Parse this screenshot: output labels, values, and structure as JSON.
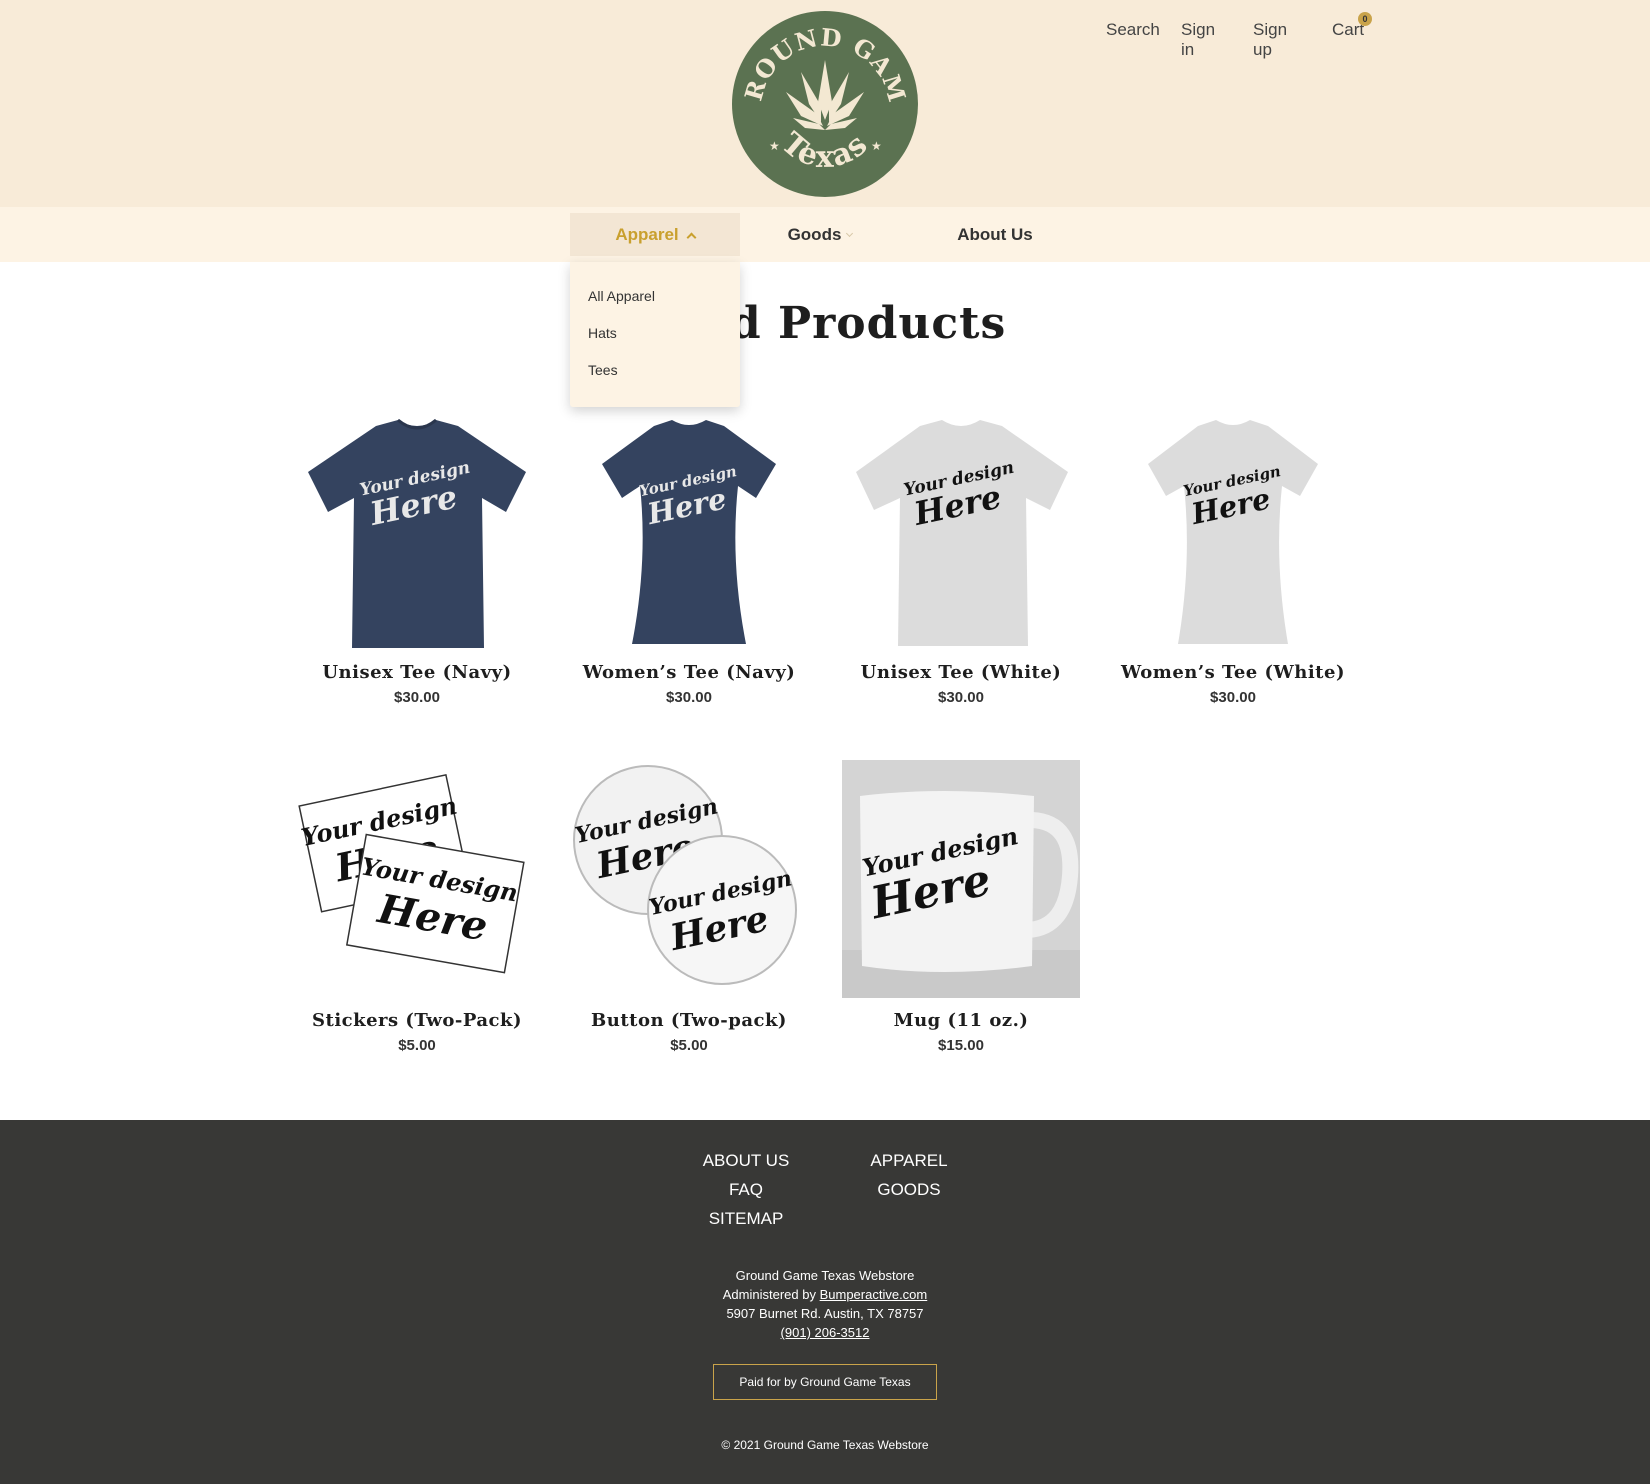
{
  "brand": {
    "logo_top_text": "GROUND GAME",
    "logo_bottom_text": "Texas",
    "colors": {
      "logo_green": "#5b7251",
      "logo_cream": "#f3e8d2",
      "accent": "#c9a02e",
      "header_bg": "#f8ebd8",
      "footer_bg": "#383836"
    }
  },
  "topnav": {
    "search": "Search",
    "signin": "Sign in",
    "signup": "Sign up",
    "cart": "Cart",
    "cart_count": "0"
  },
  "catnav": {
    "apparel": "Apparel",
    "goods": "Goods",
    "about": "About Us"
  },
  "dropdown": {
    "items": [
      "All Apparel",
      "Hats",
      "Tees"
    ]
  },
  "main": {
    "heading": "ured Products"
  },
  "products": [
    {
      "name": "Unisex Tee (Navy)",
      "price": "$30.00"
    },
    {
      "name": "Women’s Tee (Navy)",
      "price": "$30.00"
    },
    {
      "name": "Unisex Tee (White)",
      "price": "$30.00"
    },
    {
      "name": "Women’s Tee (White)",
      "price": "$30.00"
    },
    {
      "name": "Stickers (Two-Pack)",
      "price": "$5.00"
    },
    {
      "name": "Button (Two-pack)",
      "price": "$5.00"
    },
    {
      "name": "Mug (11 oz.)",
      "price": "$15.00"
    }
  ],
  "mockup": {
    "line1": "Your design",
    "line2": "Here"
  },
  "footer": {
    "links_left": [
      "ABOUT US",
      "FAQ",
      "SITEMAP"
    ],
    "links_right": [
      "APPAREL",
      "GOODS"
    ],
    "store_name": "Ground Game Texas Webstore",
    "administered_prefix": "Administered by",
    "administered_link": "Bumperactive.com",
    "address": "5907 Burnet Rd. Austin, TX 78757",
    "phone": "(901) 206-3512",
    "paid_for": "Paid for by Ground Game Texas",
    "copyright": "© 2021 Ground Game Texas Webstore"
  }
}
